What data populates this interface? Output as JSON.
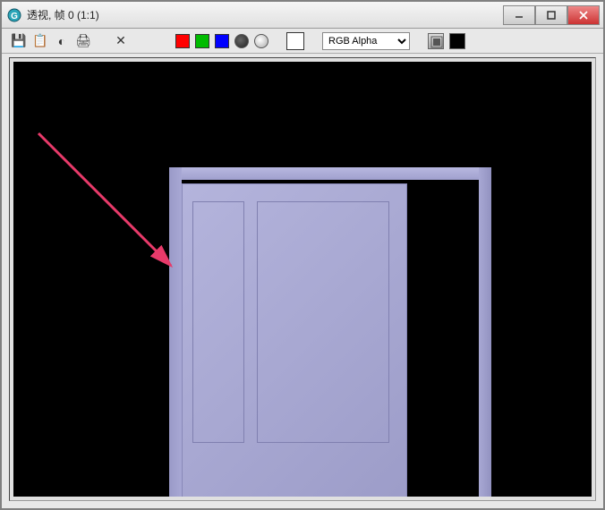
{
  "window": {
    "title": "透视, 帧 0 (1:1)"
  },
  "toolbar": {
    "save_tip": "保存",
    "copy_tip": "复制",
    "print_tip": "打印",
    "delete_tip": "删除"
  },
  "channels": {
    "dropdown_selected": "RGB Alpha",
    "dropdown_options": [
      "RGB Alpha"
    ]
  },
  "icons": {
    "save": "💾",
    "copy": "📋",
    "contrast": "◐",
    "print": "🖨",
    "delete": "✕"
  }
}
